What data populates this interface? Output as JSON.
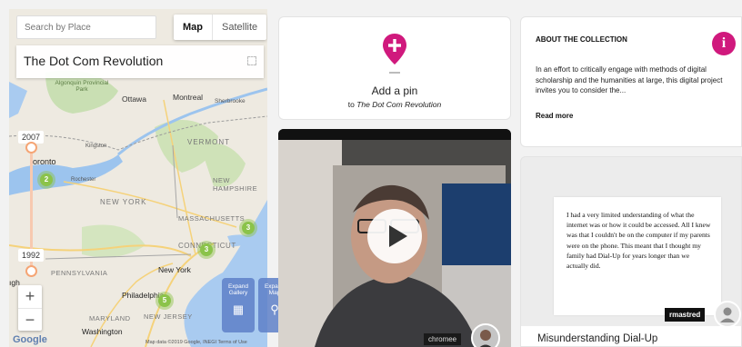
{
  "map": {
    "search_placeholder": "Search by Place",
    "type_map": "Map",
    "type_satellite": "Satellite",
    "collection_title": "The Dot Com Revolution",
    "timeline_start": "2007",
    "timeline_end": "1992",
    "zoom_in": "+",
    "zoom_out": "−",
    "expand_gallery": "Expand Gallery",
    "expand_map": "Expand Map",
    "google": "Google",
    "attribution": "Map data ©2019 Google, INEGI   Terms of Use",
    "labels": {
      "algonquin": "Algonquin Provincial Park",
      "ottawa": "Ottawa",
      "montreal": "Montreal",
      "sherbrooke": "Sherbrooke",
      "kingston": "Kingston",
      "vermont": "VERMONT",
      "toronto": "oronto",
      "rochester": "Rochester",
      "new_hampshire": "NEW HAMPSHIRE",
      "new_york_state": "NEW YORK",
      "massachusetts": "MASSACHUSETTS",
      "connecticut": "CONNECTICUT",
      "pennsylvania": "PENNSYLVANIA",
      "new_york_city": "New York",
      "pittsburgh": "ıgh",
      "philadelphia": "Philadelphia",
      "maryland": "MARYLAND",
      "new_jersey": "NEW JERSEY",
      "washington": "Washington"
    },
    "clusters": [
      "2",
      "3",
      "3",
      "5"
    ]
  },
  "addpin": {
    "line1": "Add a pin",
    "line2_prefix": "to ",
    "line2_title": "The Dot Com Revolution"
  },
  "video": {
    "username": "chromee",
    "play": "play-icon"
  },
  "about": {
    "heading": "ABOUT THE COLLECTION",
    "body": "In an effort to critically engage with methods of digital scholarship and the humanities at large, this digital project invites you to consider the...",
    "read_more": "Read more"
  },
  "document": {
    "text": "I had a very limited understanding of what the internet was or how it could be accessed. All I knew was that I couldn't be on the computer if my parents were on the phone. This meant that I thought my family had Dial-Up for years longer than we actually did.",
    "username": "rmastred",
    "title": "Misunderstanding Dial-Up"
  },
  "colors": {
    "accent_pink": "#d0197d",
    "cluster_green": "#8bc34a",
    "expand_blue": "#5e80c8"
  }
}
